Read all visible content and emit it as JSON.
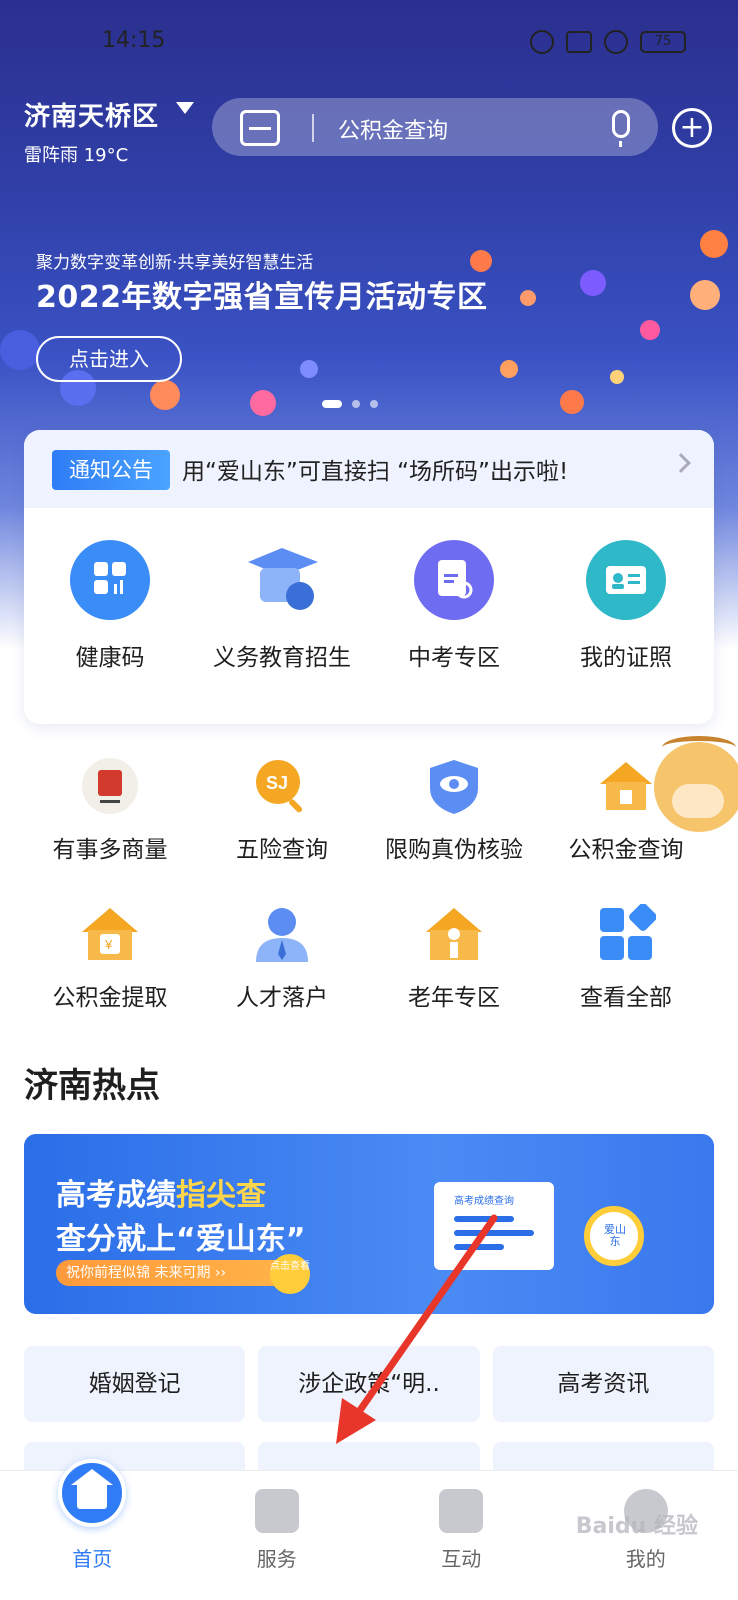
{
  "status_bar": {
    "time": "14:15",
    "battery": "75"
  },
  "header": {
    "location": "济南天桥区",
    "weather": "雷阵雨 19°C",
    "search_placeholder": "公积金查询"
  },
  "banner": {
    "subtitle": "聚力数字变革创新·共享美好智慧生活",
    "title": "2022年数字强省宣传月活动专区",
    "button": "点击进入"
  },
  "notice": {
    "tag": "通知公告",
    "text": "用“爱山东”可直接扫 “场所码”出示啦!"
  },
  "main_services": [
    {
      "label": "健康码",
      "icon": "grid-app-icon",
      "color": "#3a8cf7"
    },
    {
      "label": "义务教育招生",
      "icon": "graduation-cap-icon",
      "color": "#5b8df2"
    },
    {
      "label": "中考专区",
      "icon": "exam-doc-icon",
      "color": "#6e6cf0"
    },
    {
      "label": "我的证照",
      "icon": "id-card-icon",
      "color": "#2fb8c8"
    }
  ],
  "grid_row_1": [
    {
      "label": "有事多商量",
      "icon": "seal-icon",
      "color": "#d13a2c"
    },
    {
      "label": "五险查询",
      "icon": "si-search-icon",
      "color": "#f5a623"
    },
    {
      "label": "限购真伪核验",
      "icon": "eye-shield-icon",
      "color": "#5b8df2"
    },
    {
      "label": "公积金查询",
      "icon": "house-fund-icon",
      "color": "#f5a623"
    }
  ],
  "grid_row_2": [
    {
      "label": "公积金提取",
      "icon": "house-yuan-icon",
      "color": "#f5a623"
    },
    {
      "label": "人才落户",
      "icon": "person-icon",
      "color": "#5b8df2"
    },
    {
      "label": "老年专区",
      "icon": "elder-house-icon",
      "color": "#f5a623"
    },
    {
      "label": "查看全部",
      "icon": "all-apps-icon",
      "color": "#3a8cf7"
    }
  ],
  "hot": {
    "title": "济南热点",
    "banner_line1_a": "高考成绩",
    "banner_line1_b": "指尖查",
    "banner_line2": "查分就上“爱山东”",
    "banner_pill": "祝你前程似锦  未来可期  ››",
    "banner_click": "点击查看",
    "card_title": "高考成绩查询",
    "lens_text": "爱山东"
  },
  "tiles": [
    "婚姻登记",
    "涉企政策“明..",
    "高考资讯"
  ],
  "tabs": [
    {
      "label": "首页",
      "icon": "home-icon",
      "active": true
    },
    {
      "label": "服务",
      "icon": "service-icon",
      "active": false
    },
    {
      "label": "互动",
      "icon": "chat-doc-icon",
      "active": false
    },
    {
      "label": "我的",
      "icon": "profile-icon",
      "active": false
    }
  ],
  "watermark": "Baidu 经验",
  "colors": {
    "accent": "#2f7cf6",
    "arrow": "#e8362a"
  }
}
